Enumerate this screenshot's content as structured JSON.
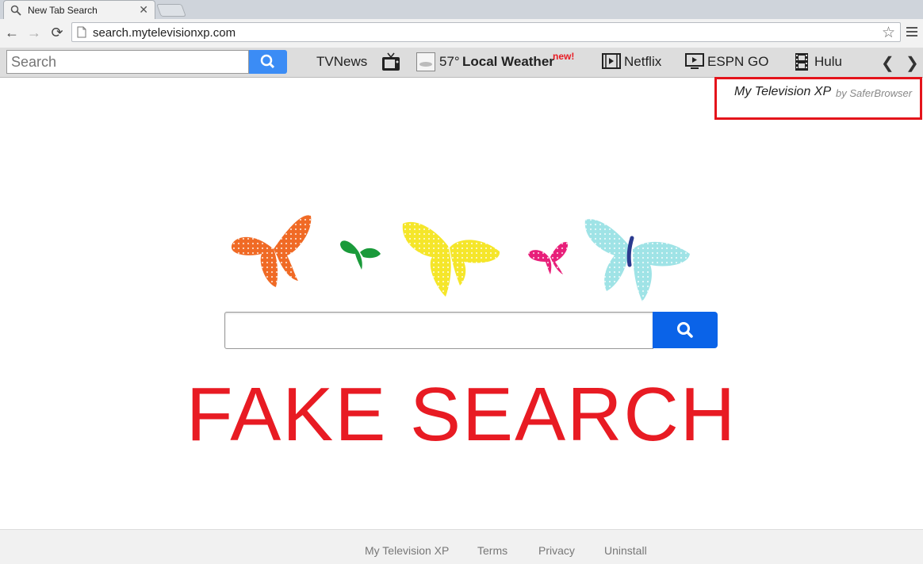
{
  "browser": {
    "tab_title": "New Tab Search",
    "tab_close": "✕",
    "url": "search.mytelevisionxp.com",
    "back": "←",
    "forward": "→",
    "reload": "⟳",
    "star": "☆"
  },
  "toolbar": {
    "search_placeholder": "Search",
    "tvnews_label": "TVNews",
    "weather_temp": "57°",
    "weather_label": "Local Weather",
    "weather_badge": "new!",
    "netflix_label": "Netflix",
    "espn_label": "ESPN GO",
    "hulu_label": "Hulu",
    "prev_arrow": "❮",
    "next_arrow": "❯"
  },
  "brand": {
    "name": "My Television XP",
    "by": "by SaferBrowser",
    "highlight_color": "#e4141b"
  },
  "main": {
    "search_value": "",
    "overlay_text": "FAKE SEARCH",
    "overlay_color": "#e81b23",
    "butterfly_colors": [
      "#f06a25",
      "#1a9a3a",
      "#f5e62a",
      "#e81f7a",
      "#9fe3e6"
    ]
  },
  "footer": {
    "links": [
      "My Television XP",
      "Terms",
      "Privacy",
      "Uninstall"
    ]
  },
  "icons": {
    "tab": "search-icon",
    "page": "page-icon",
    "tvnews": "tv-icon",
    "weather": "cloud-icon",
    "netflix": "film-icon",
    "espn": "play-icon",
    "hulu": "filmstrip-icon"
  }
}
